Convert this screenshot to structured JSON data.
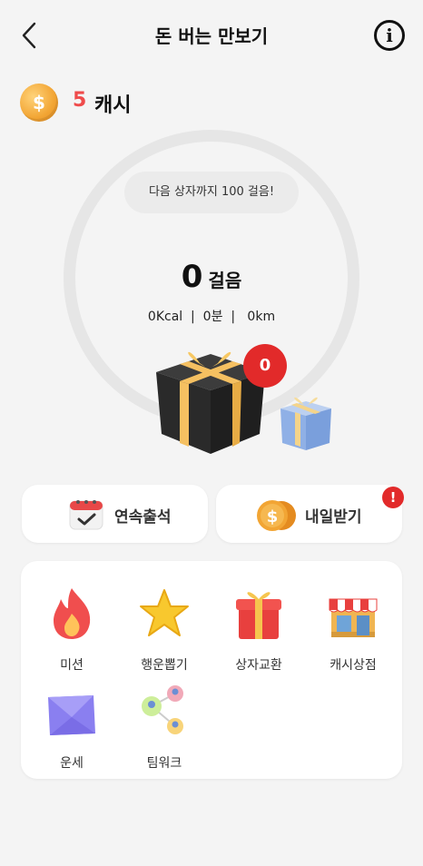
{
  "header": {
    "title": "돈 버는 만보기",
    "back_icon": "chevron-left-icon",
    "info_icon": "info-icon",
    "info_glyph": "i"
  },
  "cash": {
    "amount": "5",
    "unit": "캐시",
    "coin_symbol": "$"
  },
  "pedometer": {
    "next_box_message": "다음 상자까지 100 걸음!",
    "steps": "0",
    "steps_unit": "걸음",
    "stats": "0Kcal  |  0분  |   0km",
    "box_badge": "0"
  },
  "actions": {
    "attendance_label": "연속출석",
    "tomorrow_label": "내일받기",
    "tomorrow_alert": "!"
  },
  "menu": [
    {
      "label": "미션",
      "icon": "fire-icon"
    },
    {
      "label": "행운뽑기",
      "icon": "star-icon"
    },
    {
      "label": "상자교환",
      "icon": "gift-icon"
    },
    {
      "label": "캐시상점",
      "icon": "shop-icon"
    },
    {
      "label": "운세",
      "icon": "envelope-icon"
    },
    {
      "label": "팀워크",
      "icon": "team-icon"
    }
  ],
  "colors": {
    "accent_red": "#ef4b4b",
    "badge_red": "#e22a2a",
    "background": "#f4f4f4"
  }
}
